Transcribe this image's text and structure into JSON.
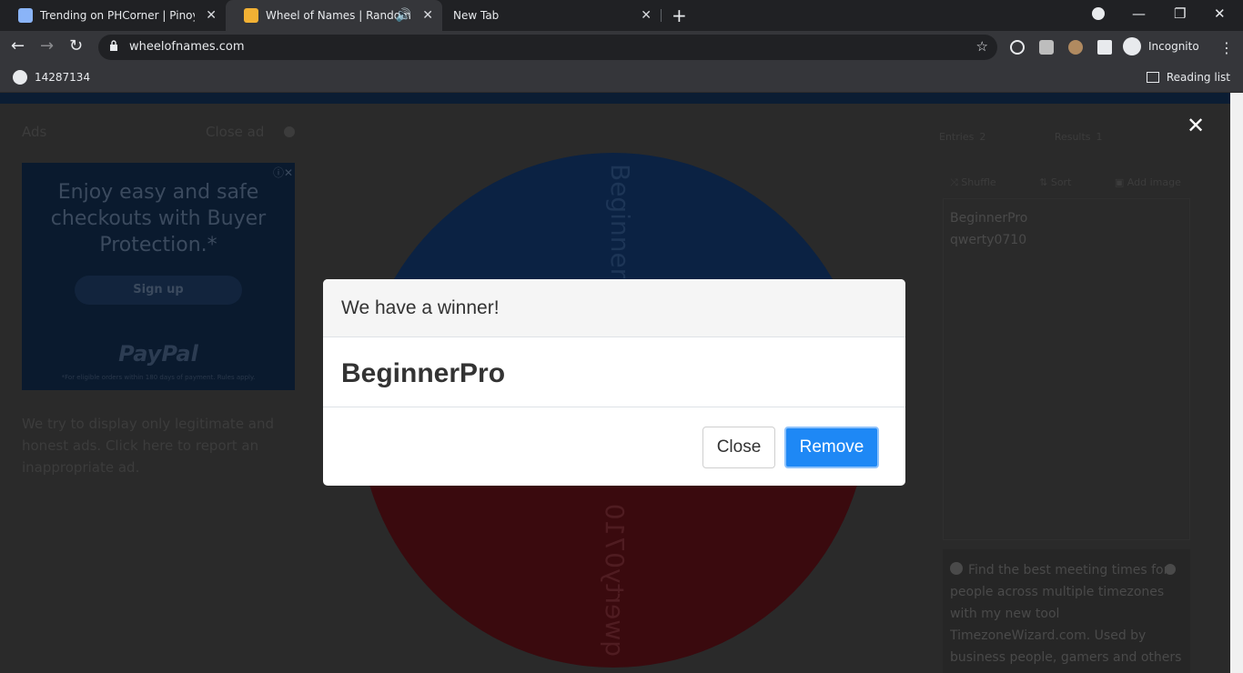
{
  "browser": {
    "tabs": [
      {
        "title": "Trending on PHCorner | Pinoy Int",
        "active": false
      },
      {
        "title": "Wheel of Names | Random n",
        "active": true
      },
      {
        "title": "New Tab",
        "active": false
      }
    ],
    "url": "wheelofnames.com",
    "profile_label": "Incognito",
    "bookmark_label": "14287134",
    "reading_list_label": "Reading list"
  },
  "sidebar_left": {
    "ads_label": "Ads",
    "close_ad_label": "Close ad",
    "ad_text": "Enjoy easy and safe checkouts with Buyer Protection.*",
    "ad_button": "Sign up",
    "ad_brand": "PayPal",
    "ad_fine": "*For eligible orders within 180 days of payment. Rules apply.",
    "note": "We try to display only legitimate and honest ads. Click here to report an inappropriate ad."
  },
  "wheel": {
    "segments": [
      {
        "label": "BeginnerPro",
        "color": "#0b2243"
      },
      {
        "label": "qwerty0710",
        "color": "#3a0a0e"
      }
    ]
  },
  "panel": {
    "entries_tab": "Entries",
    "entries_count": "2",
    "results_tab": "Results",
    "results_count": "1",
    "actions": [
      "Shuffle",
      "Sort",
      "Add image"
    ],
    "entries": [
      "BeginnerPro",
      "qwerty0710"
    ],
    "tip": "Find the best meeting times for people across multiple timezones with my new tool TimezoneWizard.com. Used by business people, gamers and others"
  },
  "modal": {
    "title": "We have a winner!",
    "winner": "BeginnerPro",
    "close_label": "Close",
    "remove_label": "Remove"
  },
  "colors": {
    "primary": "#1e88f5",
    "chrome_bg": "#202124",
    "toolbar_bg": "#35363a"
  }
}
